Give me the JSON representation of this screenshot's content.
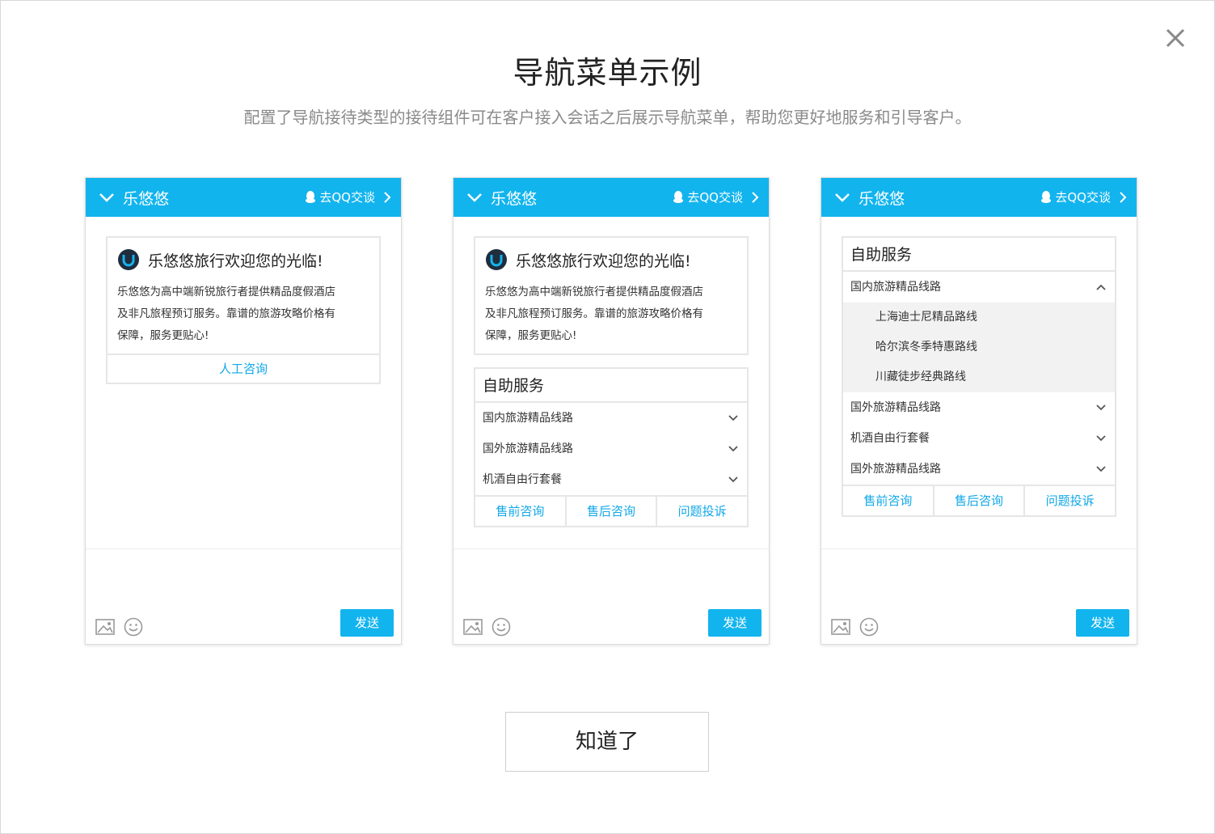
{
  "dialog": {
    "title": "导航菜单示例",
    "subtitle": "配置了导航接待类型的接待组件可在客户接入会话之后展示导航菜单，帮助您更好地服务和引导客户。",
    "confirm_label": "知道了"
  },
  "chat": {
    "name": "乐悠悠",
    "qq_link": "去QQ交谈",
    "send_label": "发送"
  },
  "welcome": {
    "title": "乐悠悠旅行欢迎您的光临!",
    "body_line1": "乐悠悠为高中端新锐旅行者提供精品度假酒店",
    "body_line2": "及非凡旅程预订服务。靠谱的旅游攻略价格有",
    "body_line3": "保障，服务更贴心!",
    "link": "人工咨询"
  },
  "menu": {
    "title": "自助服务",
    "items": [
      "国内旅游精品线路",
      "国外旅游精品线路",
      "机酒自由行套餐"
    ],
    "expanded_item": "国内旅游精品线路",
    "sub_items": [
      "上海迪士尼精品路线",
      "哈尔滨冬季特惠路线",
      "川藏徒步经典路线"
    ],
    "expanded_others": [
      "国外旅游精品线路",
      "机酒自由行套餐",
      "国外旅游精品线路"
    ],
    "buttons": [
      "售前咨询",
      "售后咨询",
      "问题投诉"
    ]
  },
  "colors": {
    "accent": "#12b4ee",
    "link": "#12a8e8"
  }
}
